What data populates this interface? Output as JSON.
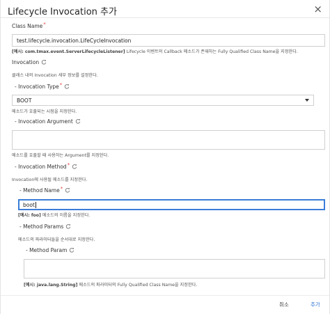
{
  "dialog": {
    "title": "Lifecycle Invocation 추가",
    "close_glyph": "×"
  },
  "class_name": {
    "label": "Class Name",
    "required_mark": "*",
    "value": "test.lifecycle.invocation.LifeCycleInvocation",
    "help_bold": "[예시: com.tmax.event.ServerLifecycleListener]",
    "help_rest": " Lifecycle 이벤트의 Callback 메소드가 존재하는 Fully Qualified Class Name을 지정한다."
  },
  "invocation": {
    "label": "Invocation",
    "help": "클래스 내의 Invocation 세부 정보를 설정한다."
  },
  "invocation_type": {
    "label": "- Invocation Type",
    "required_mark": "*",
    "value": "BOOT",
    "help": "메소드가 호출되는 시점을 지정한다."
  },
  "invocation_argument": {
    "label": "- Invocation Argument",
    "value": "",
    "help": "메소드를 호출할 때 사용하는 Argument를 지정한다."
  },
  "invocation_method": {
    "label": "- Invocation Method",
    "required_mark": "*",
    "help": "Invocation에 사용될 메소드를 지정한다."
  },
  "method_name": {
    "label": "- Method Name",
    "required_mark": "*",
    "value": "boot",
    "help_bold": "[예시: foo]",
    "help_rest": " 메소드의 이름을 지정한다."
  },
  "method_params": {
    "label": "- Method Params",
    "help": "메소드의 파라미터들을 순서대로 지정한다."
  },
  "method_param": {
    "label": "- Method Param",
    "value": "",
    "help_bold": "[예시: java.lang.String]",
    "help_rest": " 메소드의 파라미터의 Fully Qualified Class Name을 지정한다."
  },
  "footer": {
    "cancel_label": "취소",
    "ok_label": "추가"
  },
  "colors": {
    "accent": "#2b72d6",
    "required": "#e03b3b",
    "active_border": "#3b7dd8"
  }
}
